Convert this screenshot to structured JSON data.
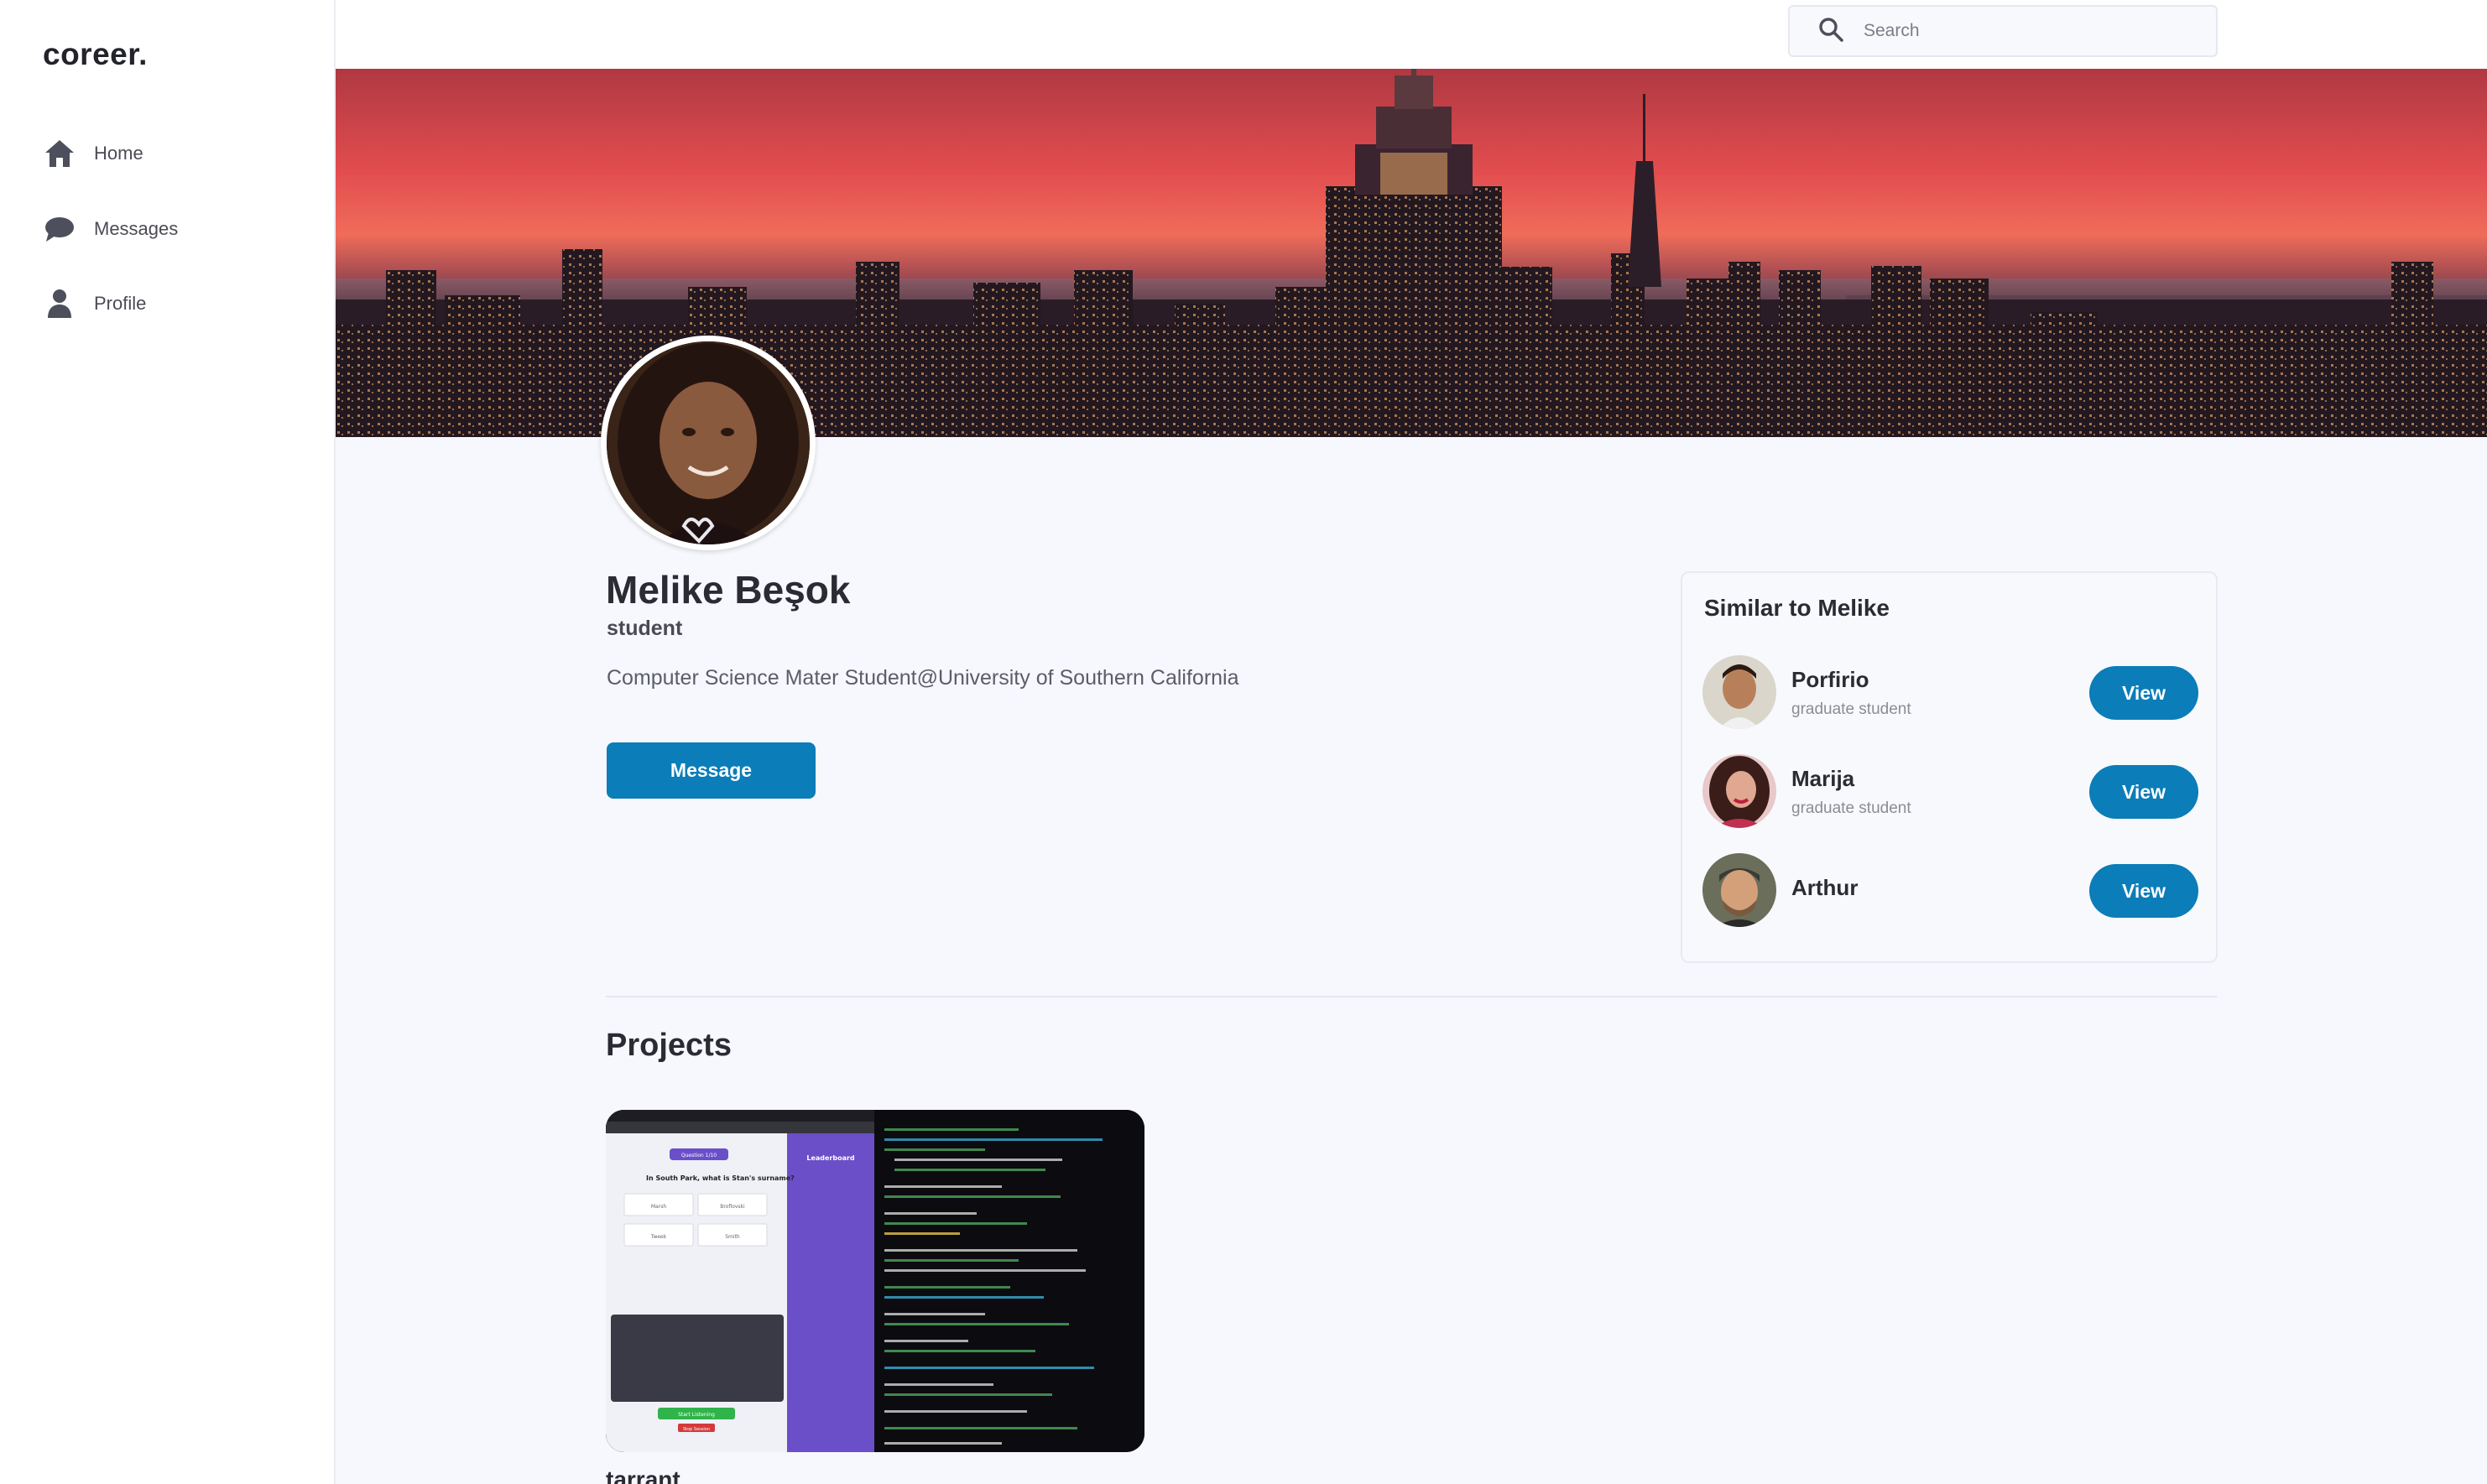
{
  "app": {
    "logo": "coreer."
  },
  "sidebar": {
    "items": [
      {
        "label": "Home",
        "icon": "home-icon"
      },
      {
        "label": "Messages",
        "icon": "chat-bubble-icon"
      },
      {
        "label": "Profile",
        "icon": "user-icon"
      }
    ]
  },
  "search": {
    "placeholder": "Search",
    "value": ""
  },
  "profile": {
    "name": "Melike Beşok",
    "role": "student",
    "bio": "Computer Science Mater Student@University of Southern California",
    "message_label": "Message"
  },
  "similar": {
    "title": "Similar to Melike",
    "people": [
      {
        "name": "Porfirio",
        "role": "graduate student",
        "button": "View"
      },
      {
        "name": "Marija",
        "role": "graduate student",
        "button": "View"
      },
      {
        "name": "Arthur",
        "role": "",
        "button": "View"
      }
    ]
  },
  "projects": {
    "title": "Projects",
    "items": [
      {
        "name": "tarrant",
        "preview": {
          "question_badge": "Question 1/10",
          "question": "In South Park, what is Stan's surname?",
          "answers": [
            "Marsh",
            "Broflovski",
            "Tweek",
            "Smith"
          ],
          "leaderboard_title": "Leaderboard",
          "start_button": "Start Listening",
          "stop_button": "Stop Session"
        }
      }
    ]
  },
  "colors": {
    "accent": "#0b7db8",
    "sidebar_bg": "#ffffff",
    "page_bg": "#f7f8fd",
    "leaderboard": "#6a4fc9"
  }
}
